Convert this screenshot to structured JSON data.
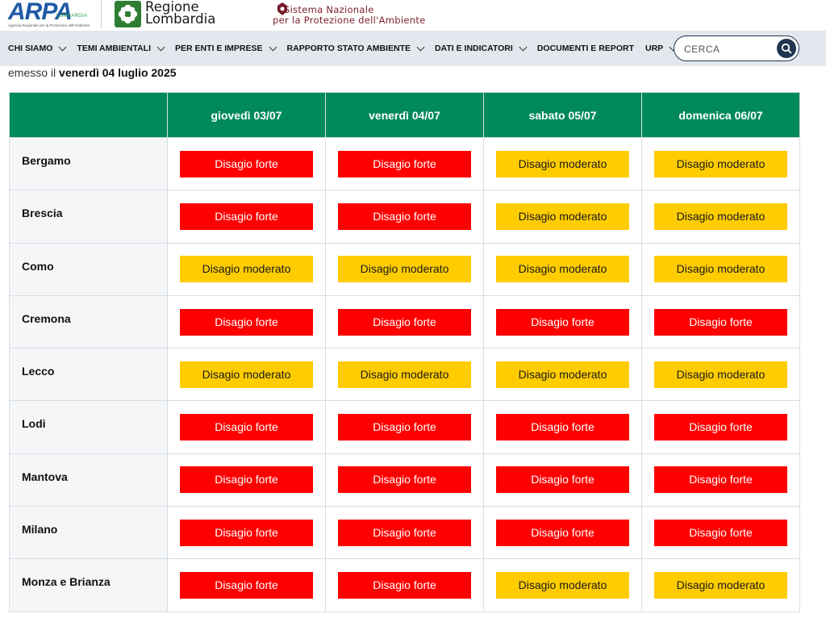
{
  "brand": {
    "arpa_word": "ARPA",
    "arpa_region": "LOMBARDIA",
    "arpa_subtitle": "Agenzia Regionale per la Protezione dell'Ambiente",
    "region_line1": "Regione",
    "region_line2": "Lombardia",
    "snpa_line1": "Sistema Nazionale",
    "snpa_line2": "per la Protezione dell'Ambiente"
  },
  "nav": {
    "items": [
      {
        "label": "CHI SIAMO",
        "dropdown": true
      },
      {
        "label": "TEMI AMBIENTALI",
        "dropdown": true
      },
      {
        "label": "PER ENTI E IMPRESE",
        "dropdown": true
      },
      {
        "label": "RAPPORTO STATO AMBIENTE",
        "dropdown": true
      },
      {
        "label": "DATI E INDICATORI",
        "dropdown": true
      },
      {
        "label": "DOCUMENTI E REPORT",
        "dropdown": false
      },
      {
        "label": "URP",
        "dropdown": true
      }
    ],
    "search_placeholder": "CERCA"
  },
  "emission": {
    "prefix": "emesso il",
    "date": "venerdì 04 luglio 2025"
  },
  "table": {
    "days": [
      "giovedì 03/07",
      "venerdì 04/07",
      "sabato 05/07",
      "domenica 06/07"
    ],
    "levels": {
      "forte": {
        "label": "Disagio forte",
        "color": "#ff0000"
      },
      "moderato": {
        "label": "Disagio moderato",
        "color": "#ffcc00"
      }
    },
    "rows": [
      {
        "city": "Bergamo",
        "values": [
          "forte",
          "forte",
          "moderato",
          "moderato"
        ]
      },
      {
        "city": "Brescia",
        "values": [
          "forte",
          "forte",
          "moderato",
          "moderato"
        ]
      },
      {
        "city": "Como",
        "values": [
          "moderato",
          "moderato",
          "moderato",
          "moderato"
        ]
      },
      {
        "city": "Cremona",
        "values": [
          "forte",
          "forte",
          "forte",
          "forte"
        ]
      },
      {
        "city": "Lecco",
        "values": [
          "moderato",
          "moderato",
          "moderato",
          "moderato"
        ]
      },
      {
        "city": "Lodi",
        "values": [
          "forte",
          "forte",
          "forte",
          "forte"
        ]
      },
      {
        "city": "Mantova",
        "values": [
          "forte",
          "forte",
          "forte",
          "forte"
        ]
      },
      {
        "city": "Milano",
        "values": [
          "forte",
          "forte",
          "forte",
          "forte"
        ]
      },
      {
        "city": "Monza e Brianza",
        "values": [
          "forte",
          "forte",
          "moderato",
          "moderato"
        ]
      }
    ]
  }
}
